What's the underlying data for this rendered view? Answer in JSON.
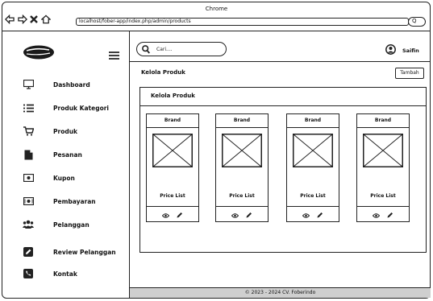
{
  "browser": {
    "title": "Chrome",
    "url": "localhost/fober-app/index.php/admin/products",
    "search_glyph": "Q"
  },
  "sidebar": {
    "logo_icon": "brand-logo-icon",
    "menu_icon": "hamburger-icon",
    "items": [
      {
        "label": "Dashboard",
        "icon": "monitor-icon"
      },
      {
        "label": "Produk Kategori",
        "icon": "list-icon"
      },
      {
        "label": "Produk",
        "icon": "cart-icon"
      },
      {
        "label": "Pesanan",
        "icon": "document-icon"
      },
      {
        "label": "Kupon",
        "icon": "ticket-icon"
      },
      {
        "label": "Pembayaran",
        "icon": "money-icon"
      },
      {
        "label": "Pelanggan",
        "icon": "users-icon"
      },
      {
        "label": "Review Pelanggan",
        "icon": "edit-icon"
      },
      {
        "label": "Kontak",
        "icon": "phone-icon"
      }
    ]
  },
  "header": {
    "search_placeholder": "Cari....",
    "user_name": "Saifin"
  },
  "main": {
    "page_title": "Kelola Produk",
    "add_button": "Tambah",
    "panel_title": "Kelola Produk",
    "products": [
      {
        "brand": "Brand",
        "price": "Price List"
      },
      {
        "brand": "Brand",
        "price": "Price List"
      },
      {
        "brand": "Brand",
        "price": "Price List"
      },
      {
        "brand": "Brand",
        "price": "Price List"
      }
    ]
  },
  "footer": {
    "text": "© 2023 - 2024 CV. Foberindo"
  }
}
